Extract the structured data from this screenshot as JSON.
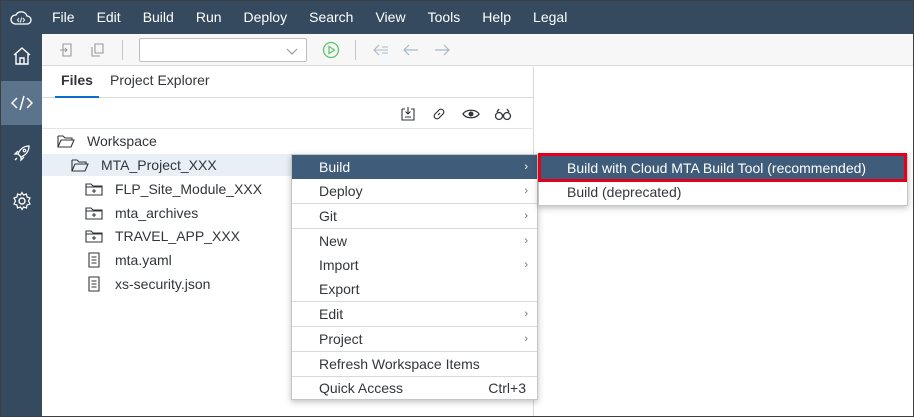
{
  "menubar": {
    "logo_icon": "code-cloud-icon",
    "items": [
      "File",
      "Edit",
      "Build",
      "Run",
      "Deploy",
      "Search",
      "View",
      "Tools",
      "Help",
      "Legal"
    ]
  },
  "rail": {
    "items": [
      {
        "icon": "home-icon",
        "active": false
      },
      {
        "icon": "code-icon",
        "active": true
      },
      {
        "icon": "rocket-icon",
        "active": false
      },
      {
        "icon": "settings-icon",
        "active": false
      }
    ]
  },
  "toolbar": {
    "run_config_value": "",
    "icons": [
      "new-file-icon",
      "copy-icon",
      "run-icon",
      "back-icon",
      "previous-icon",
      "forward-icon"
    ]
  },
  "panel": {
    "tabs": [
      "Files",
      "Project Explorer"
    ],
    "active_tab": "Files",
    "tools": [
      "collapse-all-icon",
      "link-icon",
      "show-hidden-icon",
      "search-binoculars-icon"
    ]
  },
  "tree": [
    {
      "label": "Workspace",
      "type": "folder-open",
      "level": 0
    },
    {
      "label": "MTA_Project_XXX",
      "type": "folder-open",
      "level": 1
    },
    {
      "label": "FLP_Site_Module_XXX",
      "type": "folder-module",
      "level": 2
    },
    {
      "label": "mta_archives",
      "type": "folder-module",
      "level": 2
    },
    {
      "label": "TRAVEL_APP_XXX",
      "type": "folder-module",
      "level": 2
    },
    {
      "label": "mta.yaml",
      "type": "file",
      "level": 2
    },
    {
      "label": "xs-security.json",
      "type": "file",
      "level": 2
    }
  ],
  "context_menu": {
    "items": [
      {
        "label": "Build",
        "submenu": true,
        "active": true
      },
      {
        "label": "Deploy",
        "submenu": true
      },
      {
        "label": "Git",
        "submenu": true
      },
      {
        "label": "New",
        "submenu": true
      },
      {
        "label": "Import",
        "submenu": true
      },
      {
        "label": "Export",
        "submenu": false
      },
      {
        "label": "Edit",
        "submenu": true
      },
      {
        "label": "Project",
        "submenu": true
      },
      {
        "label": "Refresh Workspace Items",
        "submenu": false
      },
      {
        "label": "Quick Access",
        "submenu": false,
        "shortcut": "Ctrl+3"
      }
    ]
  },
  "submenu": {
    "items": [
      {
        "label": "Build with Cloud MTA Build Tool (recommended)",
        "active": true
      },
      {
        "label": "Build (deprecated)",
        "active": false
      }
    ]
  },
  "colors": {
    "shell": "#354a5f",
    "rail_active": "#5b738b",
    "menu_active": "#3f5c7a",
    "highlight_border": "#e3001b"
  }
}
